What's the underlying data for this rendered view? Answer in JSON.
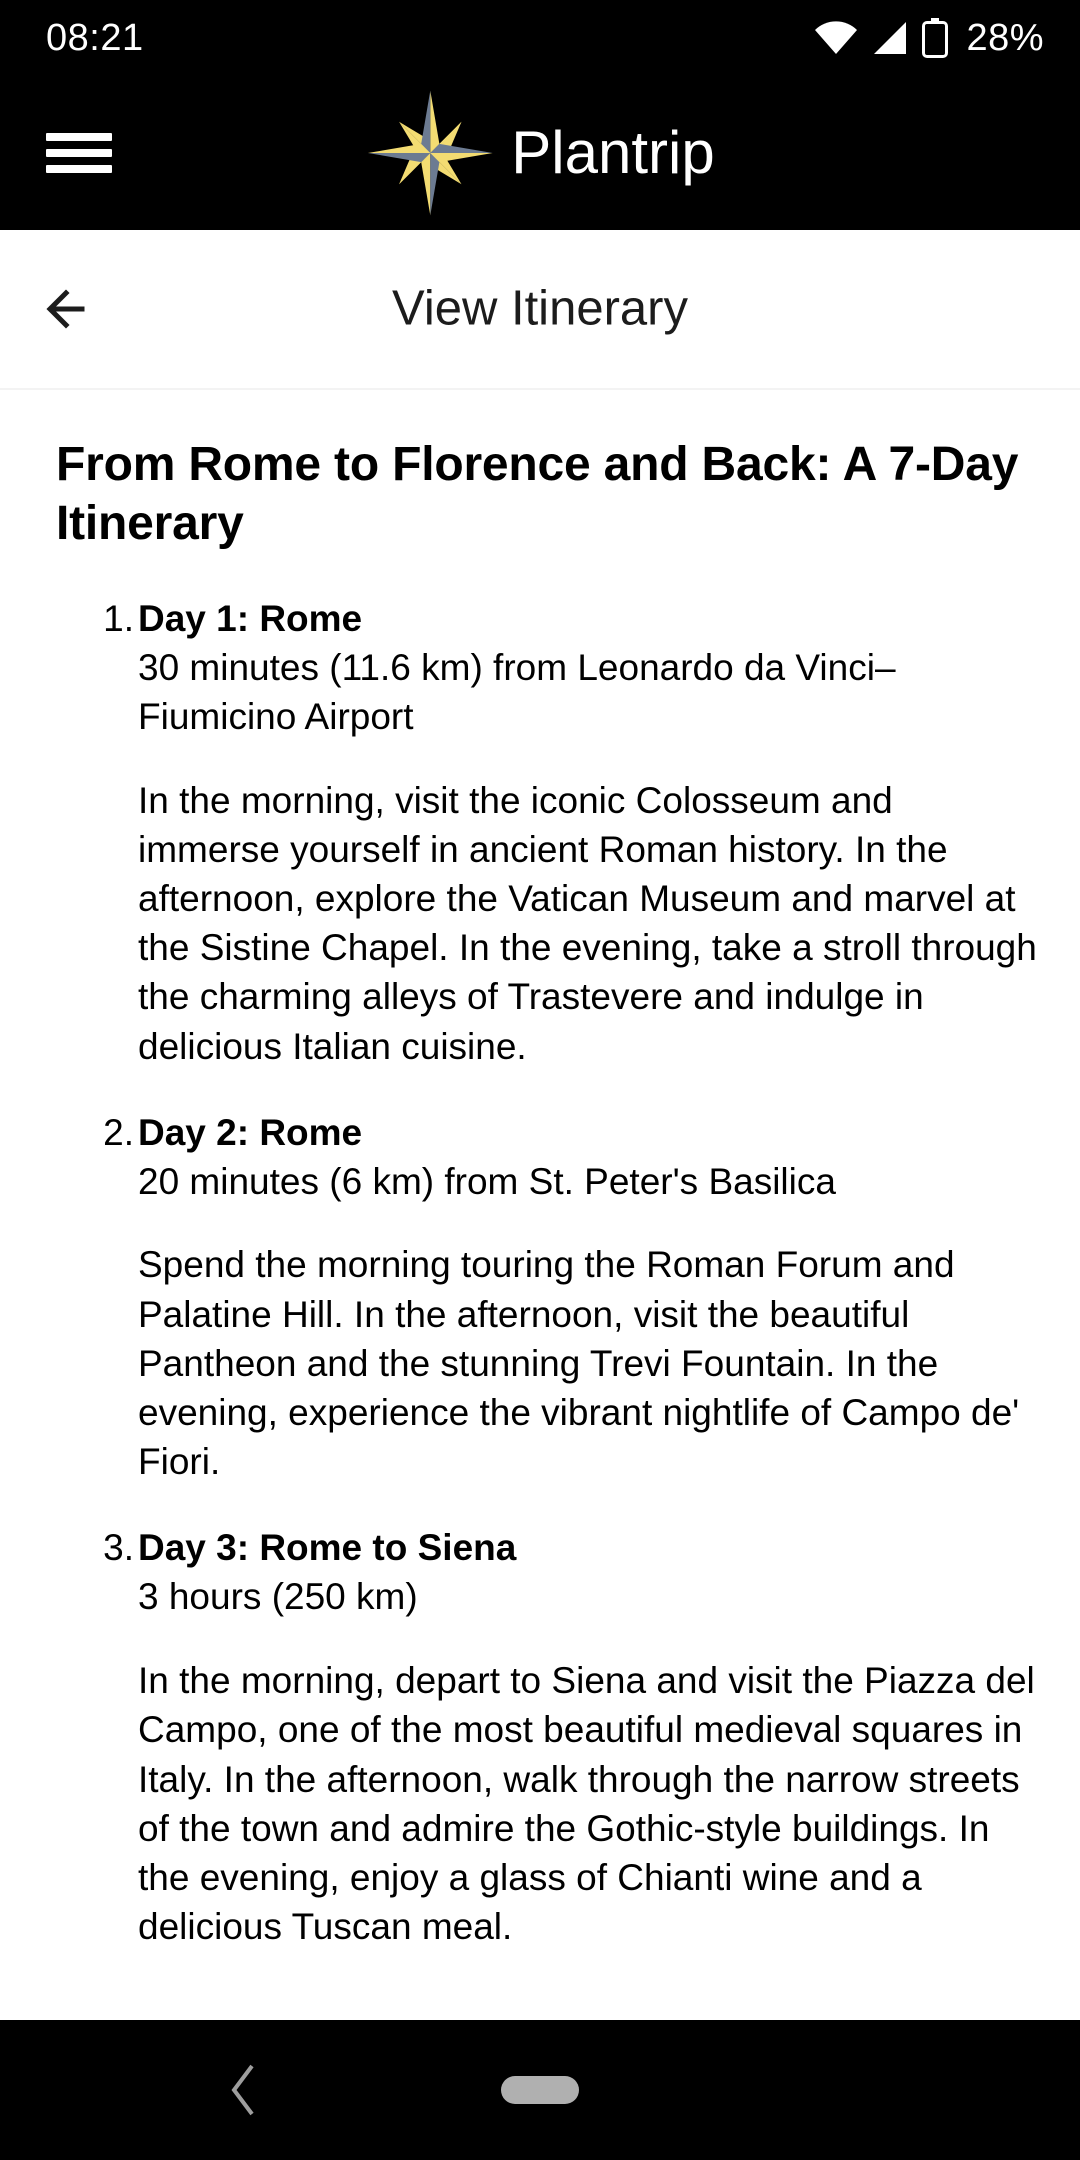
{
  "status_bar": {
    "time": "08:21",
    "battery_percent": "28%",
    "icons": [
      "wifi-icon",
      "cellular-signal-icon",
      "battery-icon"
    ]
  },
  "app_header": {
    "menu_icon": "hamburger-menu-icon",
    "logo_icon": "compass-star-icon",
    "brand_name": "Plantrip",
    "logo_colors": {
      "gold": "#F3DC72",
      "slate": "#6C7B92"
    }
  },
  "sub_header": {
    "back_icon": "back-arrow-icon",
    "title": "View Itinerary"
  },
  "document": {
    "title": "From Rome to Florence and Back: A 7-Day Itinerary",
    "days": [
      {
        "heading": "Day 1: Rome",
        "distance": "30 minutes (11.6 km) from Leonardo da Vinci–Fiumicino Airport",
        "description": "In the morning, visit the iconic Colosseum and immerse yourself in ancient Roman history. In the afternoon, explore the Vatican Museum and marvel at the Sistine Chapel. In the evening, take a stroll through the charming alleys of Trastevere and indulge in delicious Italian cuisine."
      },
      {
        "heading": "Day 2: Rome",
        "distance": "20 minutes (6 km) from St. Peter's Basilica",
        "description": "Spend the morning touring the Roman Forum and Palatine Hill. In the afternoon, visit the beautiful Pantheon and the stunning Trevi Fountain. In the evening, experience the vibrant nightlife of Campo de' Fiori."
      },
      {
        "heading": "Day 3: Rome to Siena",
        "distance": "3 hours (250 km)",
        "description": "In the morning, depart to Siena and visit the Piazza del Campo, one of the most beautiful medieval squares in Italy. In the afternoon, walk through the narrow streets of the town and admire the Gothic-style buildings. In the evening, enjoy a glass of Chianti wine and a delicious Tuscan meal."
      }
    ]
  },
  "nav_bar": {
    "back_icon": "nav-back-chevron-icon",
    "home_icon": "nav-home-pill-icon"
  }
}
